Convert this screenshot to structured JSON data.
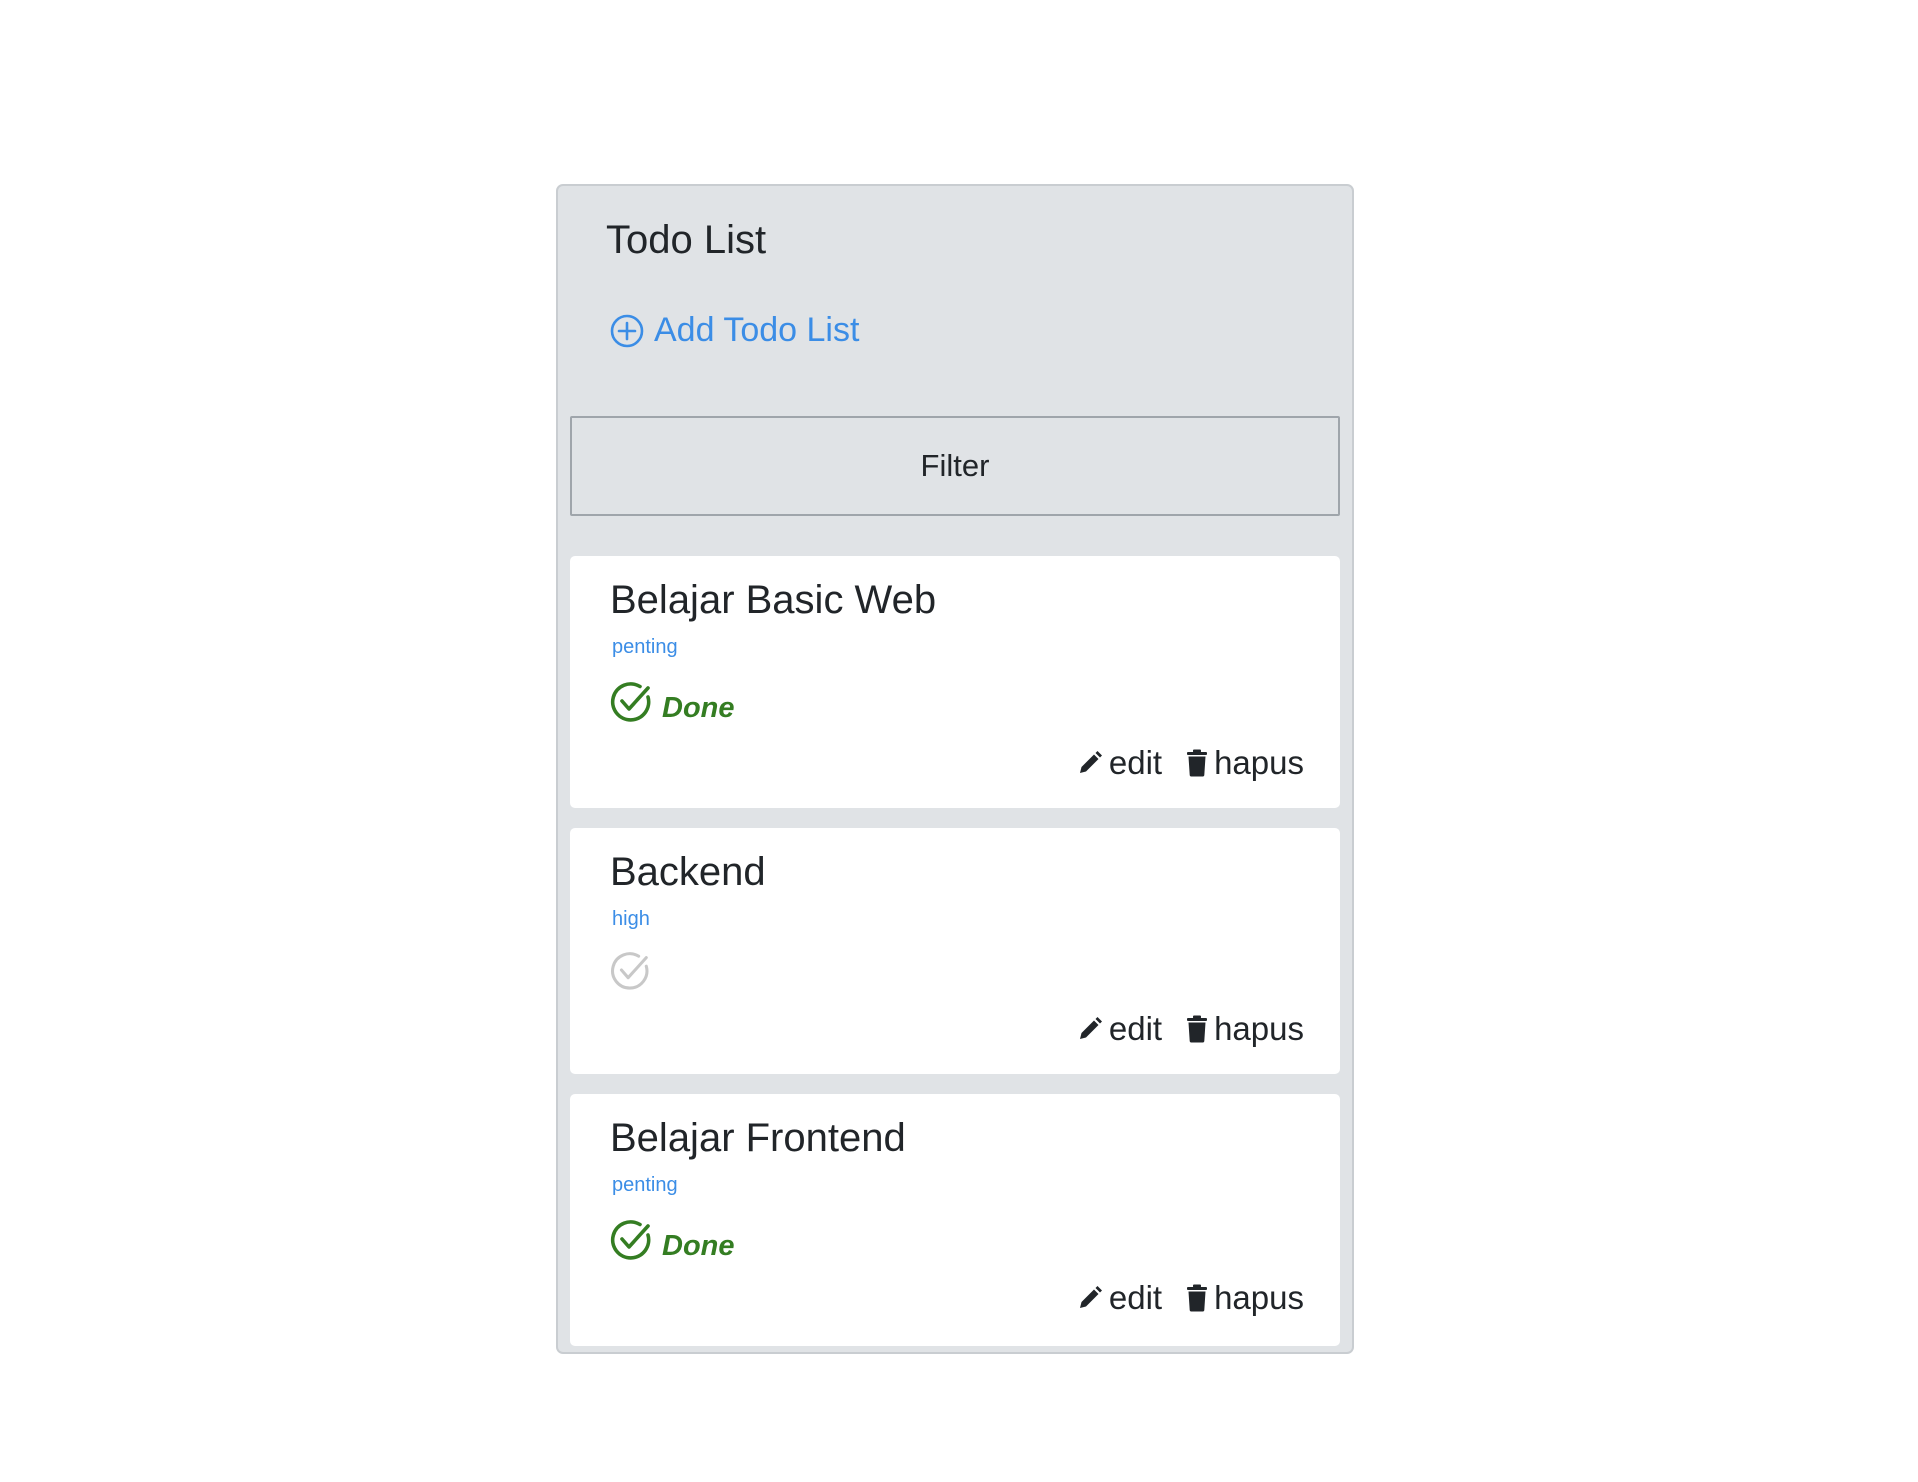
{
  "panel": {
    "title": "Todo List",
    "add_label": "Add Todo List",
    "filter_label": "Filter"
  },
  "colors": {
    "accent": "#3b8de6",
    "done": "#347d22",
    "pending_check": "#c8c8c8",
    "panel_bg": "#e0e3e6"
  },
  "todos": [
    {
      "title": "Belajar Basic Web",
      "priority": "penting",
      "done": true,
      "status_label": "Done",
      "edit_label": "edit",
      "delete_label": "hapus"
    },
    {
      "title": "Backend",
      "priority": "high",
      "done": false,
      "status_label": "",
      "edit_label": "edit",
      "delete_label": "hapus"
    },
    {
      "title": "Belajar Frontend",
      "priority": "penting",
      "done": true,
      "status_label": "Done",
      "edit_label": "edit",
      "delete_label": "hapus"
    }
  ],
  "icons": {
    "add": "plus-circle-icon",
    "done": "check-circle-icon",
    "edit": "pencil-icon",
    "delete": "trash-icon"
  }
}
